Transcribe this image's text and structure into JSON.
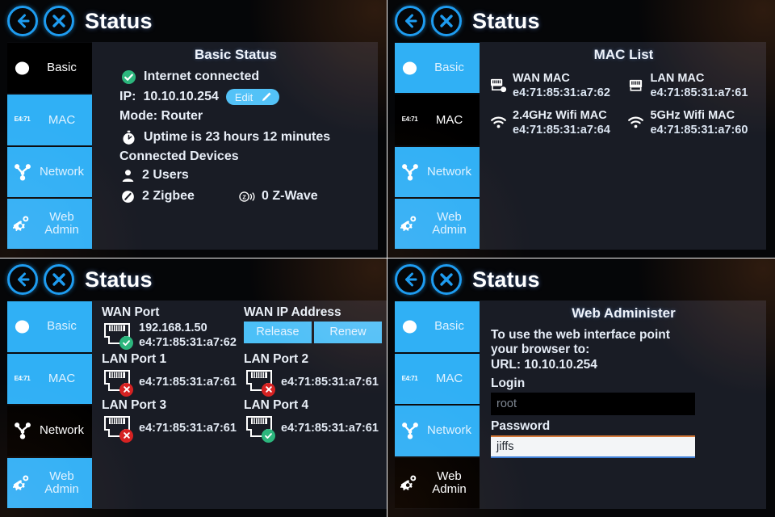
{
  "header": {
    "title": "Status",
    "back_icon": "back-arrow-icon",
    "close_icon": "close-x-icon"
  },
  "sidebar_items": [
    {
      "label": "Basic",
      "icon": "circle-icon"
    },
    {
      "label": "MAC",
      "icon": "mac-prefix-icon",
      "icon_text": "E4:71"
    },
    {
      "label": "Network",
      "icon": "network-topology-icon"
    },
    {
      "label_line1": "Web",
      "label_line2": "Admin",
      "icon": "gears-icon"
    }
  ],
  "panels": {
    "basic": {
      "title": "Basic Status",
      "internet_status": "Internet connected",
      "internet_status_icon": "green-check-icon",
      "ip_label": "IP:",
      "ip_value": "10.10.10.254",
      "edit_label": "Edit",
      "edit_icon": "pencil-icon",
      "mode": "Mode: Router",
      "uptime": "Uptime is 23 hours 12 minutes",
      "uptime_icon": "stopwatch-icon",
      "connected_devices_label": "Connected Devices",
      "users": "2 Users",
      "users_icon": "user-icon",
      "zigbee": "2 Zigbee",
      "zigbee_icon": "zigbee-icon",
      "zwave": "0 Z-Wave",
      "zwave_icon": "zwave-icon",
      "active_tab": "Basic"
    },
    "mac": {
      "title": "MAC List",
      "active_tab": "MAC",
      "entries": [
        {
          "name": "WAN MAC",
          "value": "e4:71:85:31:a7:62",
          "icon": "wan-port-icon"
        },
        {
          "name": "LAN MAC",
          "value": "e4:71:85:31:a7:61",
          "icon": "lan-port-icon"
        },
        {
          "name": "2.4GHz Wifi MAC",
          "value": "e4:71:85:31:a7:64",
          "icon": "wifi-icon"
        },
        {
          "name": "5GHz Wifi MAC",
          "value": "e4:71:85:31:a7:60",
          "icon": "wifi-icon"
        }
      ]
    },
    "network": {
      "active_tab": "Network",
      "wan_port": {
        "title": "WAN Port",
        "ip": "192.168.1.50",
        "mac": "e4:71:85:31:a7:62",
        "status": "ok",
        "icon": "rj45-port-icon"
      },
      "wan_ip": {
        "title": "WAN IP Address",
        "release_label": "Release",
        "renew_label": "Renew"
      },
      "lan_ports": [
        {
          "title": "LAN Port 1",
          "mac": "e4:71:85:31:a7:61",
          "status": "bad",
          "icon": "rj45-port-icon"
        },
        {
          "title": "LAN Port 2",
          "mac": "e4:71:85:31:a7:61",
          "status": "bad",
          "icon": "rj45-port-icon"
        },
        {
          "title": "LAN Port 3",
          "mac": "e4:71:85:31:a7:61",
          "status": "bad",
          "icon": "rj45-port-icon"
        },
        {
          "title": "LAN Port 4",
          "mac": "e4:71:85:31:a7:61",
          "status": "ok",
          "icon": "rj45-port-icon"
        }
      ]
    },
    "webadmin": {
      "title": "Web Administer",
      "active_tab": "Web Admin",
      "instructions_line1": "To use the web interface point",
      "instructions_line2": "your browser to:",
      "url_line": "URL: 10.10.10.254",
      "login_label": "Login",
      "login_value": "root",
      "password_label": "Password",
      "password_value": "jiffs"
    }
  },
  "colors": {
    "accent_blue": "#30b0f5",
    "header_blue": "#1e9cf0",
    "screen_bg": "#191c25",
    "ok_green": "#2cb67d",
    "bad_red": "#d62222",
    "focus_orange": "#d4793a"
  }
}
